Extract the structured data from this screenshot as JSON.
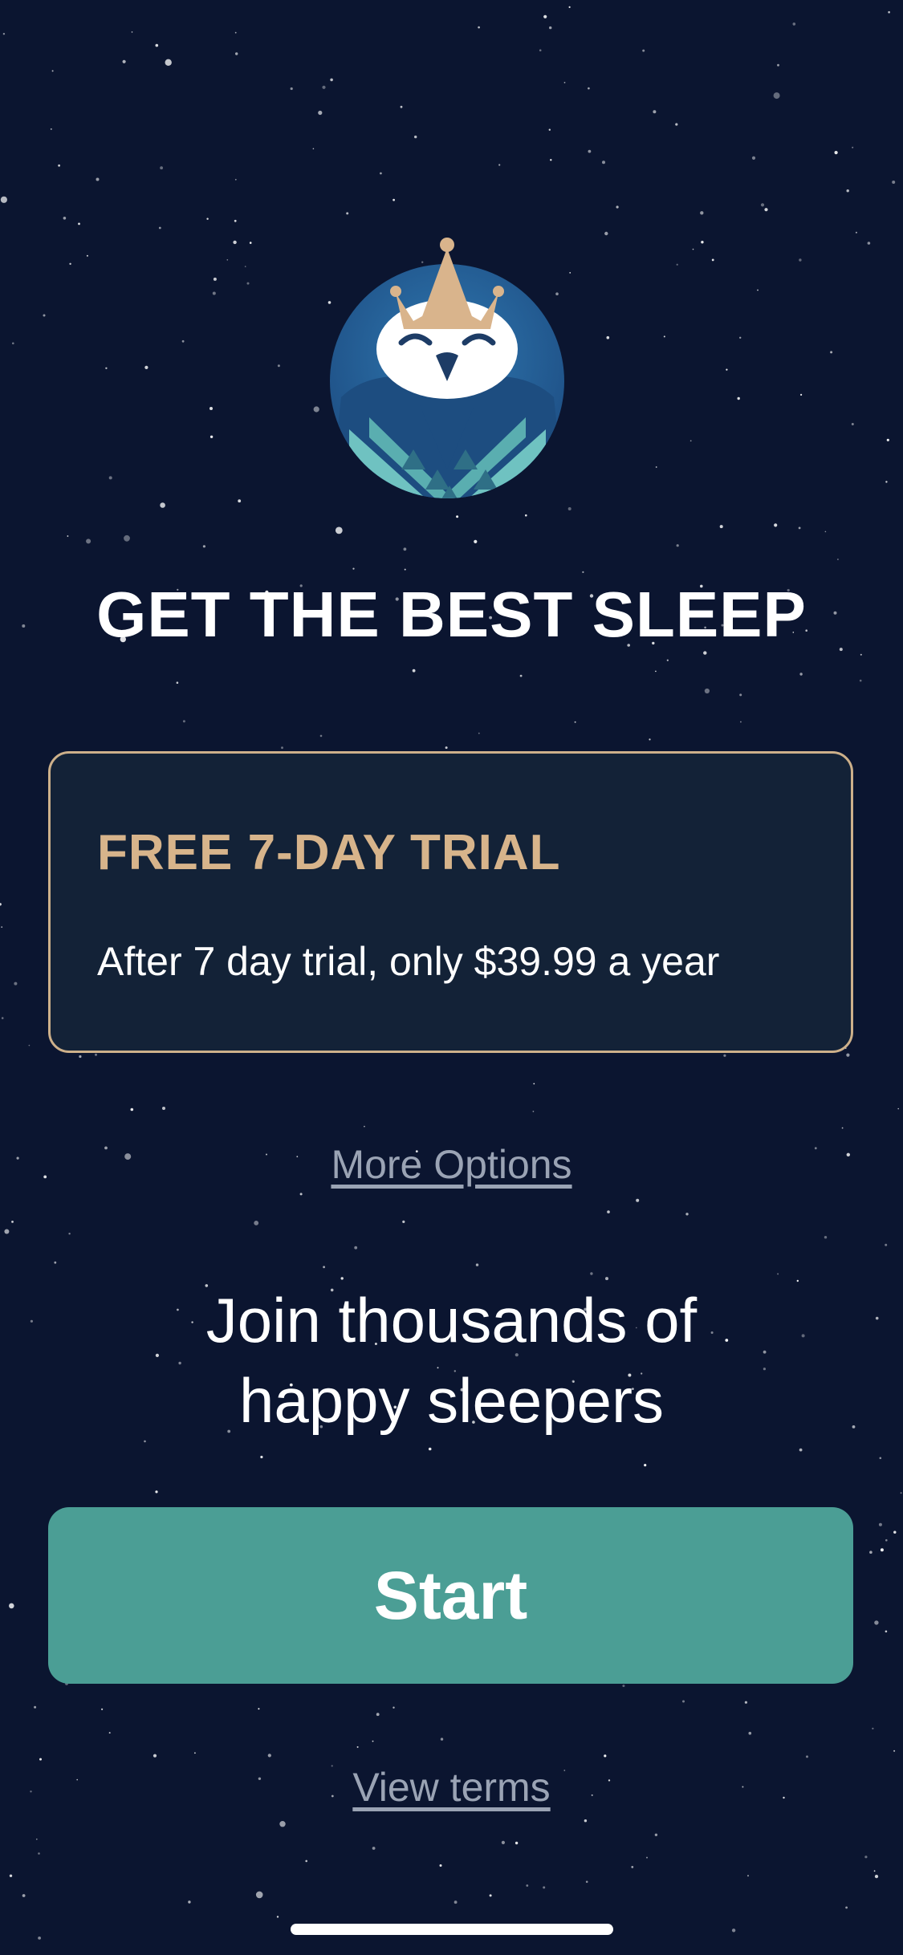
{
  "logo": {
    "name": "crowned-owl-logo",
    "colors": {
      "crown": "#d9b48c",
      "circle": "#2b6aa0",
      "body": "#6fc2c1",
      "face": "#ffffff"
    }
  },
  "headline": "GET THE BEST SLEEP",
  "offer": {
    "title": "FREE 7-DAY TRIAL",
    "subtitle": "After 7 day trial, only $39.99 a year"
  },
  "links": {
    "more_options": "More Options",
    "view_terms": "View terms"
  },
  "tagline": {
    "line1": "Join thousands of",
    "line2": "happy sleepers"
  },
  "cta": {
    "start_label": "Start"
  },
  "colors": {
    "background": "#0b1530",
    "accent_gold": "#cdb08a",
    "button_teal": "#4b9e95",
    "link_gray": "#9aa3b4"
  }
}
